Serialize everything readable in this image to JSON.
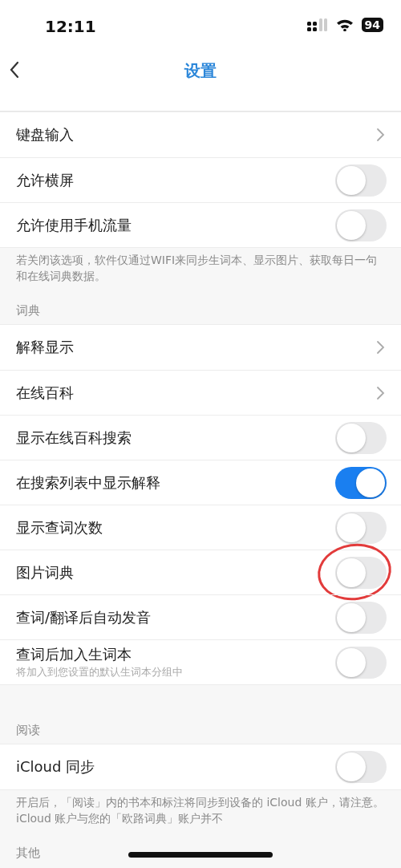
{
  "status_bar": {
    "time": "12:11",
    "battery": "94"
  },
  "nav_bar": {
    "title": "设置"
  },
  "blocks": [
    {
      "kind": "group",
      "rows": [
        {
          "kind": "link",
          "label": "键盘输入"
        },
        {
          "kind": "toggle",
          "label": "允许横屏",
          "on": false,
          "circled": false
        },
        {
          "kind": "toggle",
          "label": "允许使用手机流量",
          "on": false,
          "circled": false
        }
      ]
    },
    {
      "kind": "footnote",
      "text": "若关闭该选项，软件仅通过WIFI来同步生词本、显示图片、获取每日一句和在线词典数据。"
    },
    {
      "kind": "header",
      "text": "词典"
    },
    {
      "kind": "group",
      "rows": [
        {
          "kind": "link",
          "label": "解释显示"
        },
        {
          "kind": "link",
          "label": "在线百科"
        },
        {
          "kind": "toggle",
          "label": "显示在线百科搜索",
          "on": false,
          "circled": false
        },
        {
          "kind": "toggle",
          "label": "在搜索列表中显示解释",
          "on": true,
          "circled": false
        },
        {
          "kind": "toggle",
          "label": "显示查词次数",
          "on": false,
          "circled": false
        },
        {
          "kind": "toggle",
          "label": "图片词典",
          "on": false,
          "circled": true
        },
        {
          "kind": "toggle",
          "label": "查词/翻译后自动发音",
          "on": false,
          "circled": false
        },
        {
          "kind": "toggle",
          "label": "查词后加入生词本",
          "subtitle": "将加入到您设置的默认生词本分组中",
          "on": false,
          "circled": false
        }
      ]
    },
    {
      "kind": "header",
      "text": "阅读"
    },
    {
      "kind": "group",
      "rows": [
        {
          "kind": "toggle",
          "label": "iCloud 同步",
          "on": false,
          "circled": false
        }
      ]
    },
    {
      "kind": "footnote",
      "text": "开启后，「阅读」内的书本和标注将同步到设备的 iCloud 账户，请注意。iCloud 账户与您的「欧路词典」账户并不"
    },
    {
      "kind": "header",
      "text": "其他"
    }
  ]
}
